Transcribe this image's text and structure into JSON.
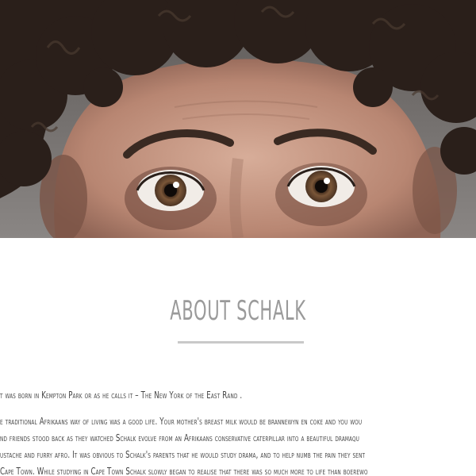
{
  "hero": {
    "image_alt": "Close-up portrait of Schalk with curly hair and wide eyes",
    "colors": {
      "background": "#7f7b79",
      "skin": "#c79a86",
      "hair": "#2a1f1a",
      "iris": "#6b4a32"
    }
  },
  "about": {
    "title": "ABOUT SCHALK",
    "paragraphs": [
      "t was born in Kempton Park or as he calls it – The New York of the East Rand .",
      "e traditional Afrikaans way of living was a good life. Your mother's breast milk would be brannewyn en coke and you wou",
      "nd friends stood back as they watched Schalk evolve from an Afrikaans conservative caterpillar into a beautiful dramaqu",
      "ustache and furry afro. It was obvious to Schalk's parents that he would study drama, and to help numb the pain they sent",
      "Cape Town. While studying in Cape Town Schalk slowly began to realise that there was so much more to life than boerewo"
    ],
    "accent_color": "#c9c9c9",
    "title_color": "#9a9a9a"
  }
}
